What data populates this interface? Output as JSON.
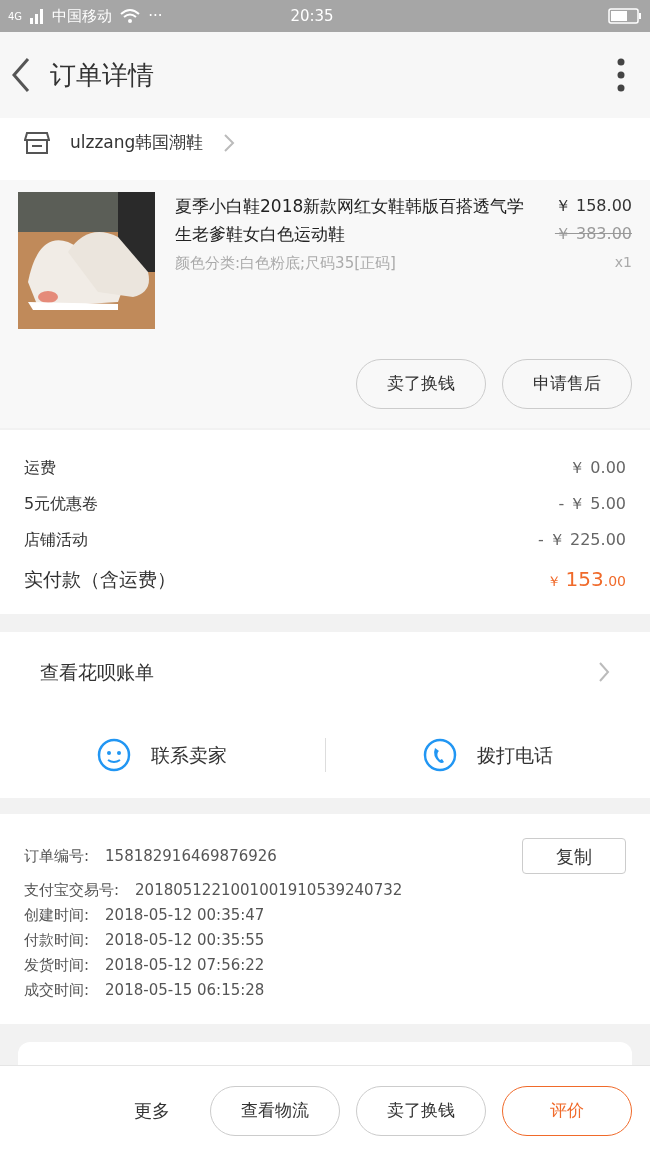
{
  "status_bar": {
    "network": "4G",
    "carrier": "中国移动",
    "extra": "···",
    "time": "20:35"
  },
  "header": {
    "title": "订单详情"
  },
  "shop": {
    "name": "ulzzang韩国潮鞋"
  },
  "product": {
    "title": "夏季小白鞋2018新款网红女鞋韩版百搭透气学生老爹鞋女白色运动鞋",
    "price": "￥ 158.00",
    "original_price": "￥ 383.00",
    "spec": "颜色分类:白色粉底;尺码35[正码]",
    "quantity": "x1",
    "buttons": [
      "卖了换钱",
      "申请售后"
    ]
  },
  "charges": [
    {
      "label": "运费",
      "value": "￥ 0.00"
    },
    {
      "label": "5元优惠卷",
      "value": "- ￥ 5.00"
    },
    {
      "label": "店铺活动",
      "value": "- ￥ 225.00"
    }
  ],
  "total": {
    "label": "实付款（含运费）",
    "currency": "￥",
    "amount": "153",
    "decimals": ".00"
  },
  "huabei": {
    "label": "查看花呗账单"
  },
  "contact": [
    {
      "kind": "chat",
      "label": "联系卖家"
    },
    {
      "kind": "phone",
      "label": "拨打电话"
    }
  ],
  "order_info": {
    "copy_button": "复制",
    "rows": [
      {
        "label": "订单编号:",
        "value": "158182916469876926"
      },
      {
        "label": "支付宝交易号:",
        "value": "2018051221001001910539240732"
      },
      {
        "label": "创建时间:",
        "value": "2018-05-12 00:35:47"
      },
      {
        "label": "付款时间:",
        "value": "2018-05-12 00:35:55"
      },
      {
        "label": "发货时间:",
        "value": "2018-05-12 07:56:22"
      },
      {
        "label": "成交时间:",
        "value": "2018-05-15 06:15:28"
      }
    ]
  },
  "bottom_bar": {
    "more": "更多",
    "buttons": [
      {
        "label": "查看物流",
        "kind": "plain"
      },
      {
        "label": "卖了换钱",
        "kind": "plain"
      },
      {
        "label": "评价",
        "kind": "primary"
      }
    ]
  }
}
